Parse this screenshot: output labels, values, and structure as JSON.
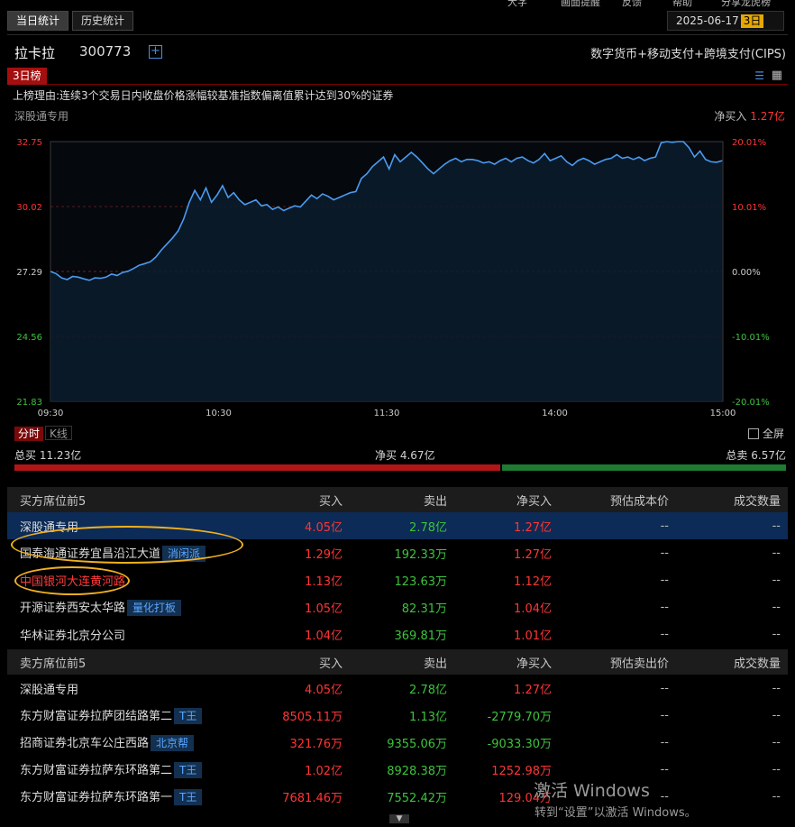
{
  "top_strip": [
    "大字",
    "画面提醒",
    "反馈",
    "帮助",
    "分享龙虎榜"
  ],
  "tabs": [
    {
      "label": "当日统计",
      "active": true
    },
    {
      "label": "历史统计",
      "active": false
    }
  ],
  "date": {
    "value": "2025-06-17",
    "badge": "3日"
  },
  "stock": {
    "name": "拉卡拉",
    "code": "300773",
    "concepts": "数字货币+移动支付+跨境支付(CIPS)"
  },
  "board": {
    "tag": "3日榜",
    "reason": "上榜理由:连续3个交易日内收盘价格涨幅较基准指数偏离值累计达到30%的证券"
  },
  "chart_header": {
    "seat": "深股通专用",
    "net_label": "净买入",
    "net_value": "1.27亿"
  },
  "chart_data": {
    "type": "line",
    "title": "",
    "x_ticks": [
      "09:30",
      "10:30",
      "11:30",
      "14:00",
      "15:00"
    ],
    "y_ticks_left": [
      "32.75",
      "30.02",
      "27.29",
      "24.56",
      "21.83"
    ],
    "y_ticks_right": [
      "20.01%",
      "10.01%",
      "0.00%",
      "-10.01%",
      "-20.01%"
    ],
    "ylim": [
      21.83,
      32.75
    ],
    "prev_close": 27.29,
    "line_color": "#4a9bf0",
    "series": [
      {
        "values": [
          27.29,
          27.2,
          27.02,
          26.95,
          27.08,
          27.05,
          26.98,
          26.92,
          27.02,
          27.0,
          27.05,
          27.18,
          27.12,
          27.25,
          27.3,
          27.42,
          27.55,
          27.62,
          27.7,
          27.9,
          28.2,
          28.45,
          28.7,
          29.0,
          29.5,
          30.2,
          30.7,
          30.3,
          30.8,
          30.2,
          30.5,
          30.9,
          30.4,
          30.6,
          30.3,
          30.1,
          30.2,
          30.3,
          30.05,
          30.1,
          29.9,
          30.0,
          29.85,
          29.95,
          30.05,
          30.0,
          30.25,
          30.5,
          30.35,
          30.55,
          30.45,
          30.3,
          30.4,
          30.5,
          30.6,
          30.65,
          31.2,
          31.4,
          31.7,
          31.9,
          32.1,
          31.6,
          32.2,
          31.9,
          32.1,
          32.3,
          32.1,
          31.85,
          31.6,
          31.4,
          31.6,
          31.8,
          31.95,
          32.05,
          31.9,
          32.0,
          32.0,
          31.95,
          31.85,
          31.9,
          31.8,
          31.95,
          32.05,
          31.9,
          32.05,
          32.1,
          31.95,
          31.85,
          32.0,
          32.25,
          31.95,
          32.05,
          32.15,
          31.9,
          31.75,
          31.95,
          32.05,
          31.95,
          31.8,
          31.9,
          32.0,
          32.05,
          32.2,
          32.05,
          32.1,
          32.0,
          32.1,
          31.95,
          32.05,
          32.1,
          32.7,
          32.75,
          32.72,
          32.75,
          32.75,
          32.5,
          32.1,
          32.35,
          32.0,
          31.9,
          31.88,
          31.95
        ]
      }
    ]
  },
  "period_tabs": [
    "分时",
    "K线"
  ],
  "fullscreen_label": "全屏",
  "totals": {
    "buy_label": "总买",
    "buy_value": "11.23亿",
    "net_label": "净买",
    "net_value": "4.67亿",
    "sell_label": "总卖",
    "sell_value": "6.57亿",
    "buy_ratio": 0.63
  },
  "buy_table": {
    "headers": [
      "买方席位前5",
      "买入",
      "卖出",
      "净买入",
      "预估成本价",
      "成交数量"
    ],
    "rows": [
      {
        "name": "深股通专用",
        "tag": "",
        "buy": "4.05亿",
        "sell": "2.78亿",
        "net": "1.27亿",
        "cost": "--",
        "vol": "--"
      },
      {
        "name": "国泰海通证券宜昌沿江大道",
        "tag": "消闲派",
        "buy": "1.29亿",
        "sell": "192.33万",
        "net": "1.27亿",
        "cost": "--",
        "vol": "--"
      },
      {
        "name": "中国银河大连黄河路",
        "tag": "",
        "buy": "1.13亿",
        "sell": "123.63万",
        "net": "1.12亿",
        "cost": "--",
        "vol": "--"
      },
      {
        "name": "开源证券西安太华路",
        "tag": "量化打板",
        "buy": "1.05亿",
        "sell": "82.31万",
        "net": "1.04亿",
        "cost": "--",
        "vol": "--"
      },
      {
        "name": "华林证券北京分公司",
        "tag": "",
        "buy": "1.04亿",
        "sell": "369.81万",
        "net": "1.01亿",
        "cost": "--",
        "vol": "--"
      }
    ]
  },
  "sell_table": {
    "headers": [
      "卖方席位前5",
      "买入",
      "卖出",
      "净买入",
      "预估卖出价",
      "成交数量"
    ],
    "rows": [
      {
        "name": "深股通专用",
        "tag": "",
        "buy": "4.05亿",
        "sell": "2.78亿",
        "net": "1.27亿",
        "cost": "--",
        "vol": "--"
      },
      {
        "name": "东方财富证券拉萨团结路第二",
        "tag": "T王",
        "buy": "8505.11万",
        "sell": "1.13亿",
        "net": "-2779.70万",
        "cost": "--",
        "vol": "--"
      },
      {
        "name": "招商证券北京车公庄西路",
        "tag": "北京帮",
        "buy": "321.76万",
        "sell": "9355.06万",
        "net": "-9033.30万",
        "cost": "--",
        "vol": "--"
      },
      {
        "name": "东方财富证券拉萨东环路第二",
        "tag": "T王",
        "buy": "1.02亿",
        "sell": "8928.38万",
        "net": "1252.98万",
        "cost": "--",
        "vol": "--"
      },
      {
        "name": "东方财富证券拉萨东环路第一",
        "tag": "T王",
        "buy": "7681.46万",
        "sell": "7552.42万",
        "net": "129.04万",
        "cost": "--",
        "vol": "--"
      }
    ]
  },
  "watermark": {
    "line1": "激活 Windows",
    "line2": "转到“设置”以激活 Windows。"
  }
}
